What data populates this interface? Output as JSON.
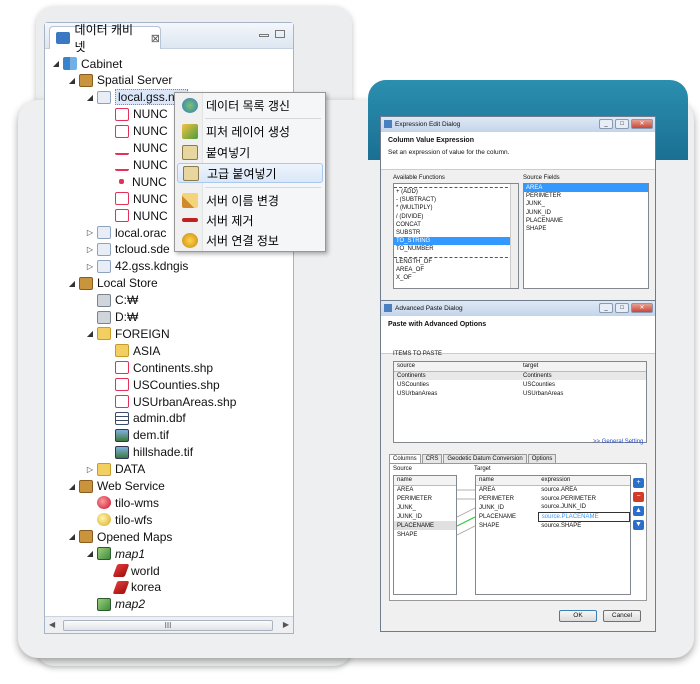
{
  "cabinet": {
    "tab_title": "데이터 캐비넷",
    "close_glyph": "⊠",
    "scroll_thumb": "III",
    "tree": [
      {
        "label": "Cabinet",
        "icon": "cabinet-icon"
      },
      {
        "label": "Spatial Server",
        "icon": "box-icon"
      },
      {
        "label": "local.gss.n...",
        "icon": "server-icon"
      },
      {
        "label": "NUNC",
        "icon": "polygon-icon"
      },
      {
        "label": "NUNC",
        "icon": "polygon-icon"
      },
      {
        "label": "NUNC",
        "icon": "line-icon"
      },
      {
        "label": "NUNC",
        "icon": "line-icon"
      },
      {
        "label": "NUNC",
        "icon": "point-icon"
      },
      {
        "label": "NUNC",
        "icon": "polygon-icon"
      },
      {
        "label": "NUNC",
        "icon": "polygon-icon"
      },
      {
        "label": "local.orac",
        "icon": "server-icon"
      },
      {
        "label": "tcloud.sde",
        "icon": "server-icon"
      },
      {
        "label": "42.gss.kdngis",
        "icon": "server-icon"
      },
      {
        "label": "Local Store",
        "icon": "box-icon"
      },
      {
        "label": "C:₩",
        "icon": "drive-icon"
      },
      {
        "label": "D:₩",
        "icon": "drive-icon"
      },
      {
        "label": "FOREIGN",
        "icon": "folder-icon"
      },
      {
        "label": "ASIA",
        "icon": "folder-icon"
      },
      {
        "label": "Continents.shp",
        "icon": "shapefile-icon"
      },
      {
        "label": "USCounties.shp",
        "icon": "shapefile-icon"
      },
      {
        "label": "USUrbanAreas.shp",
        "icon": "shapefile-icon"
      },
      {
        "label": "admin.dbf",
        "icon": "table-icon"
      },
      {
        "label": "dem.tif",
        "icon": "raster-icon"
      },
      {
        "label": "hillshade.tif",
        "icon": "raster-icon"
      },
      {
        "label": "DATA",
        "icon": "folder-icon"
      },
      {
        "label": "Web Service",
        "icon": "box-icon"
      },
      {
        "label": "tilo-wms",
        "icon": "globe-icon"
      },
      {
        "label": "tilo-wfs",
        "icon": "globe-icon"
      },
      {
        "label": "Opened Maps",
        "icon": "box-icon"
      },
      {
        "label": "map1",
        "icon": "map-icon"
      },
      {
        "label": "world",
        "icon": "layer-icon"
      },
      {
        "label": "korea",
        "icon": "layer-icon"
      },
      {
        "label": "map2",
        "icon": "map-icon"
      }
    ]
  },
  "context_menu": {
    "items": [
      "데이터 목록 갱신",
      "피처 레이어 생성",
      "붙여넣기",
      "고급 붙여넣기",
      "서버 이름 변경",
      "서버 제거",
      "서버 연결 정보"
    ]
  },
  "expr_dialog": {
    "title": "Expression Edit Dialog",
    "heading": "Column Value Expression",
    "description": "Set an expression of value for the column.",
    "functions_label": "Available Functions",
    "source_label": "Source Fields",
    "functions": [
      "+ (ADD)",
      "- (SUBTRACT)",
      "* (MULTIPLY)",
      "/ (DIVIDE)",
      "CONCAT",
      "SUBSTR",
      "TO_STRING",
      "TO_NUMBER",
      "LENGTH_OF",
      "AREA_OF",
      "X_OF"
    ],
    "fields": [
      "AREA",
      "PERIMETER",
      "JUNK_",
      "JUNK_ID",
      "PLACENAME",
      "SHAPE"
    ]
  },
  "paste_dialog": {
    "title": "Advanced Paste Dialog",
    "heading": "Paste with Advanced Options",
    "items_label": "ITEMS TO PASTE",
    "items_header": [
      "source",
      "target"
    ],
    "items": [
      [
        "Continents",
        "Continents"
      ],
      [
        "USCounties",
        "USCounties"
      ],
      [
        "USUrbanAreas",
        "USUrbanAreas"
      ]
    ],
    "general_link": ">> General Setting",
    "tabs": [
      "Columns",
      "CRS",
      "Geodetic Datum Conversion",
      "Options"
    ],
    "source_label": "Source",
    "target_label": "Target",
    "source_header": "name",
    "source_cols": [
      "AREA",
      "PERIMETER",
      "JUNK_",
      "JUNK_ID",
      "PLACENAME",
      "SHAPE"
    ],
    "target_header": [
      "name",
      "expression"
    ],
    "target_rows": [
      [
        "AREA",
        "source.AREA"
      ],
      [
        "PERIMETER",
        "source.PERIMETER"
      ],
      [
        "JUNK_ID",
        "source.JUNK_ID"
      ],
      [
        "PLACENAME",
        "source.PLACENAME"
      ],
      [
        "SHAPE",
        "source.SHAPE"
      ]
    ],
    "ok_label": "OK",
    "cancel_label": "Cancel"
  }
}
